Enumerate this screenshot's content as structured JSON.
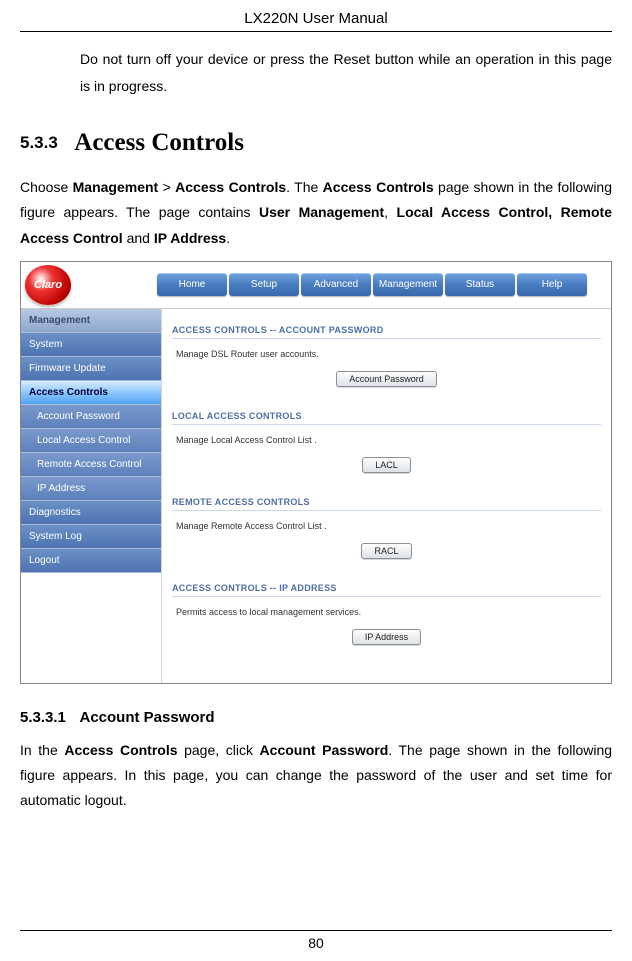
{
  "doc": {
    "header": "LX220N User Manual",
    "warning": "Do not turn off your device or press the Reset button while an operation in this page is in progress.",
    "section_num": "5.3.3",
    "section_title": "Access Controls",
    "intro_prefix": "Choose ",
    "intro_b1": "Management",
    "intro_sep1": " > ",
    "intro_b2": "Access Controls",
    "intro_mid1": ". The ",
    "intro_b3": "Access Controls",
    "intro_mid2": " page shown in the following figure appears. The page contains ",
    "intro_b4": "User Management",
    "intro_mid3": ", ",
    "intro_b5": "Local Access Control, Remote Access Control",
    "intro_mid4": " and ",
    "intro_b6": "IP Address",
    "intro_end": ".",
    "sub_num": "5.3.3.1",
    "sub_title": "Account Password",
    "sub_p_prefix": "In the ",
    "sub_p_b1": "Access Controls",
    "sub_p_mid1": " page, click ",
    "sub_p_b2": "Account Password",
    "sub_p_end": ". The page shown in the following figure appears. In this page, you can change the password of the user and set time for automatic logout.",
    "pagenum": "80"
  },
  "router": {
    "logo": "Claro",
    "topnav": [
      "Home",
      "Setup",
      "Advanced",
      "Management",
      "Status",
      "Help"
    ],
    "sidebar": {
      "head": "Management",
      "items": [
        "System",
        "Firmware Update",
        "Access Controls"
      ],
      "subs": [
        "Account Password",
        "Local Access Control",
        "Remote Access Control",
        "IP Address"
      ],
      "items2": [
        "Diagnostics",
        "System Log",
        "Logout"
      ]
    },
    "panels": [
      {
        "head": "ACCESS CONTROLS -- ACCOUNT PASSWORD",
        "desc": "Manage DSL Router user accounts.",
        "btn": "Account Password"
      },
      {
        "head": "LOCAL ACCESS CONTROLS",
        "desc": "Manage Local Access Control List .",
        "btn": "LACL"
      },
      {
        "head": "REMOTE ACCESS CONTROLS",
        "desc": "Manage Remote Access Control List .",
        "btn": "RACL"
      },
      {
        "head": "ACCESS CONTROLS -- IP ADDRESS",
        "desc": "Permits access to local management services.",
        "btn": "IP Address"
      }
    ]
  }
}
